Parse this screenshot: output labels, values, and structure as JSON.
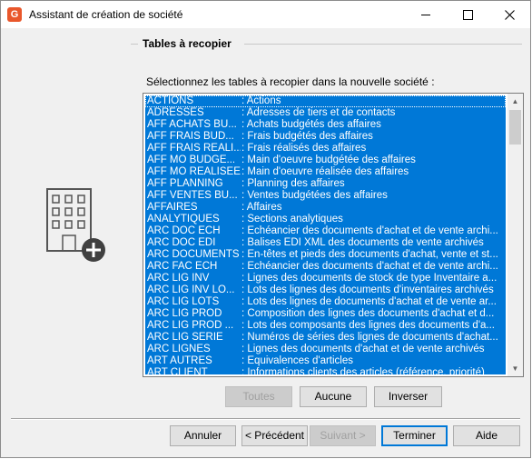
{
  "window": {
    "title": "Assistant de création de société",
    "app_icon_letter": "G"
  },
  "group": {
    "title": "Tables à recopier"
  },
  "instruction": "Sélectionnez les tables à recopier dans la nouvelle société :",
  "tables": [
    {
      "code": "ACTIONS",
      "desc": ": Actions"
    },
    {
      "code": "ADRESSES",
      "desc": ": Adresses de tiers et de contacts"
    },
    {
      "code": "AFF ACHATS BU...",
      "desc": ": Achats budgétés des affaires"
    },
    {
      "code": "AFF FRAIS BUD...",
      "desc": ": Frais budgétés des affaires"
    },
    {
      "code": "AFF FRAIS REALI...",
      "desc": ": Frais réalisés des affaires"
    },
    {
      "code": "AFF MO BUDGE...",
      "desc": ": Main d'oeuvre budgétée des affaires"
    },
    {
      "code": "AFF MO REALISEE",
      "desc": ": Main d'oeuvre réalisée des affaires"
    },
    {
      "code": "AFF PLANNING",
      "desc": ": Planning des affaires"
    },
    {
      "code": "AFF VENTES BU...",
      "desc": ": Ventes budgétées des affaires"
    },
    {
      "code": "AFFAIRES",
      "desc": ": Affaires"
    },
    {
      "code": "ANALYTIQUES",
      "desc": ": Sections analytiques"
    },
    {
      "code": "ARC DOC ECH",
      "desc": ": Echéancier des documents d'achat et de vente archi..."
    },
    {
      "code": "ARC DOC EDI",
      "desc": ": Balises EDI XML des documents de vente archivés"
    },
    {
      "code": "ARC DOCUMENTS",
      "desc": ": En-têtes et pieds des documents d'achat, vente et st..."
    },
    {
      "code": "ARC FAC ECH",
      "desc": ": Echéancier des documents d'achat et de vente archi..."
    },
    {
      "code": "ARC LIG INV",
      "desc": ": Lignes des documents de stock de type Inventaire a..."
    },
    {
      "code": "ARC LIG INV LO...",
      "desc": ": Lots des lignes des documents d'inventaires archivés"
    },
    {
      "code": "ARC LIG LOTS",
      "desc": ": Lots des lignes de documents d'achat et de vente ar..."
    },
    {
      "code": "ARC LIG PROD",
      "desc": ": Composition des lignes des documents d'achat et d..."
    },
    {
      "code": "ARC LIG PROD ...",
      "desc": ": Lots des composants des lignes des documents d'a..."
    },
    {
      "code": "ARC LIG SERIE",
      "desc": ": Numéros de séries des lignes de documents d'achat..."
    },
    {
      "code": "ARC LIGNES",
      "desc": ": Lignes des documents d'achat et de vente archivés"
    },
    {
      "code": "ART AUTRES",
      "desc": ": Equivalences d'articles"
    },
    {
      "code": "ART CLIENT",
      "desc": ": Informations clients des articles (référence, priorité)"
    }
  ],
  "list_buttons": {
    "all": "Toutes",
    "none": "Aucune",
    "invert": "Inverser"
  },
  "footer_buttons": {
    "cancel": "Annuler",
    "previous": "< Précédent",
    "next": "Suivant >",
    "finish": "Terminer",
    "help": "Aide"
  },
  "colors": {
    "selection": "#0078d7",
    "dialog_bg": "#f0f0f0"
  }
}
